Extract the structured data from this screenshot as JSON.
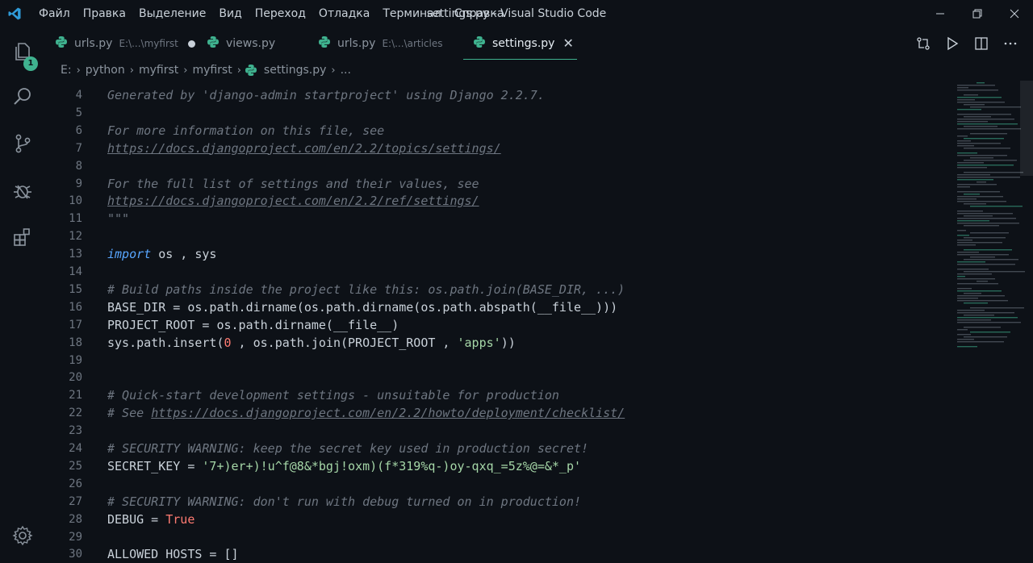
{
  "window": {
    "title": "settings.py - Visual Studio Code",
    "menu": [
      "Файл",
      "Правка",
      "Выделение",
      "Вид",
      "Переход",
      "Отладка",
      "Терминал",
      "Справка"
    ]
  },
  "activity_bar": {
    "items": [
      {
        "name": "explorer",
        "badge": "1"
      },
      {
        "name": "search"
      },
      {
        "name": "source-control"
      },
      {
        "name": "debug"
      },
      {
        "name": "extensions"
      }
    ],
    "settings": "settings"
  },
  "tabs": [
    {
      "label": "urls.py",
      "description": "E:\\...\\myfirst",
      "modified": true,
      "active": false
    },
    {
      "label": "views.py",
      "description": "",
      "modified": false,
      "active": false
    },
    {
      "label": "urls.py",
      "description": "E:\\...\\articles",
      "modified": false,
      "active": false
    },
    {
      "label": "settings.py",
      "description": "",
      "modified": false,
      "active": true,
      "close": "✕"
    }
  ],
  "breadcrumb": [
    "E:",
    "python",
    "myfirst",
    "myfirst",
    "settings.py",
    "..."
  ],
  "editor": {
    "lines": [
      {
        "n": "4",
        "text": "Generated by 'django-admin startproject' using Django 2.2.7."
      },
      {
        "n": "5",
        "text": ""
      },
      {
        "n": "6",
        "text": "For more information on this file, see"
      },
      {
        "n": "7",
        "text": "https://docs.djangoproject.com/en/2.2/topics/settings/"
      },
      {
        "n": "8",
        "text": ""
      },
      {
        "n": "9",
        "text": "For the full list of settings and their values, see"
      },
      {
        "n": "10",
        "text": "https://docs.djangoproject.com/en/2.2/ref/settings/"
      },
      {
        "n": "11",
        "text": "\"\"\""
      },
      {
        "n": "12",
        "text": ""
      },
      {
        "n": "13",
        "text": "import os , sys"
      },
      {
        "n": "14",
        "text": ""
      },
      {
        "n": "15",
        "text": "# Build paths inside the project like this: os.path.join(BASE_DIR, ...)"
      },
      {
        "n": "16",
        "text": "BASE_DIR = os.path.dirname(os.path.dirname(os.path.abspath(__file__)))"
      },
      {
        "n": "17",
        "text": "PROJECT_ROOT = os.path.dirname(__file__)"
      },
      {
        "n": "18",
        "text": "sys.path.insert(0 , os.path.join(PROJECT_ROOT , 'apps'))"
      },
      {
        "n": "19",
        "text": ""
      },
      {
        "n": "20",
        "text": ""
      },
      {
        "n": "21",
        "text": "# Quick-start development settings - unsuitable for production"
      },
      {
        "n": "22",
        "text": "# See https://docs.djangoproject.com/en/2.2/howto/deployment/checklist/"
      },
      {
        "n": "23",
        "text": ""
      },
      {
        "n": "24",
        "text": "# SECURITY WARNING: keep the secret key used in production secret!"
      },
      {
        "n": "25",
        "text": "SECRET_KEY = '7+)er+)!u^f@8&*bgj!oxm)(f*319%q-)oy-qxq_=5z%@=&*_p'"
      },
      {
        "n": "26",
        "text": ""
      },
      {
        "n": "27",
        "text": "# SECURITY WARNING: don't run with debug turned on in production!"
      },
      {
        "n": "28",
        "text": "DEBUG = True"
      },
      {
        "n": "29",
        "text": ""
      },
      {
        "n": "30",
        "text": "ALLOWED_HOSTS = []"
      }
    ]
  },
  "colors": {
    "background": "#0d1117",
    "accent": "#3fb28f",
    "keyword": "#58a6ff",
    "string": "#a5d6a7",
    "number": "#ff7b72",
    "comment": "#6e7681"
  }
}
